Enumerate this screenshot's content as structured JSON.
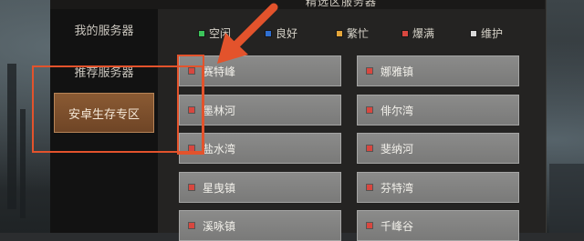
{
  "window": {
    "title": "精选区服务器"
  },
  "nav": {
    "items": [
      {
        "label": "我的服务器",
        "active": false
      },
      {
        "label": "推荐服务器",
        "active": false
      },
      {
        "label": "安卓生存专区",
        "active": true
      }
    ]
  },
  "legend": [
    {
      "label": "空闲",
      "color": "#3cc35a"
    },
    {
      "label": "良好",
      "color": "#2f6fd1"
    },
    {
      "label": "繁忙",
      "color": "#e5a63a"
    },
    {
      "label": "爆满",
      "color": "#d8473f"
    },
    {
      "label": "维护",
      "color": "#d8d8d8"
    }
  ],
  "servers": [
    {
      "name": "赛特峰",
      "status_color": "#d8473f"
    },
    {
      "name": "娜雅镇",
      "status_color": "#d8473f"
    },
    {
      "name": "墨林河",
      "status_color": "#d8473f"
    },
    {
      "name": "俳尔湾",
      "status_color": "#d8473f"
    },
    {
      "name": "盐水湾",
      "status_color": "#d8473f"
    },
    {
      "name": "斐纳河",
      "status_color": "#d8473f"
    },
    {
      "name": "星曳镇",
      "status_color": "#d8473f"
    },
    {
      "name": "芬特湾",
      "status_color": "#d8473f"
    },
    {
      "name": "溪咏镇",
      "status_color": "#d8473f"
    },
    {
      "name": "千峰谷",
      "status_color": "#d8473f"
    }
  ],
  "annotation": {
    "color": "#e3532c"
  }
}
